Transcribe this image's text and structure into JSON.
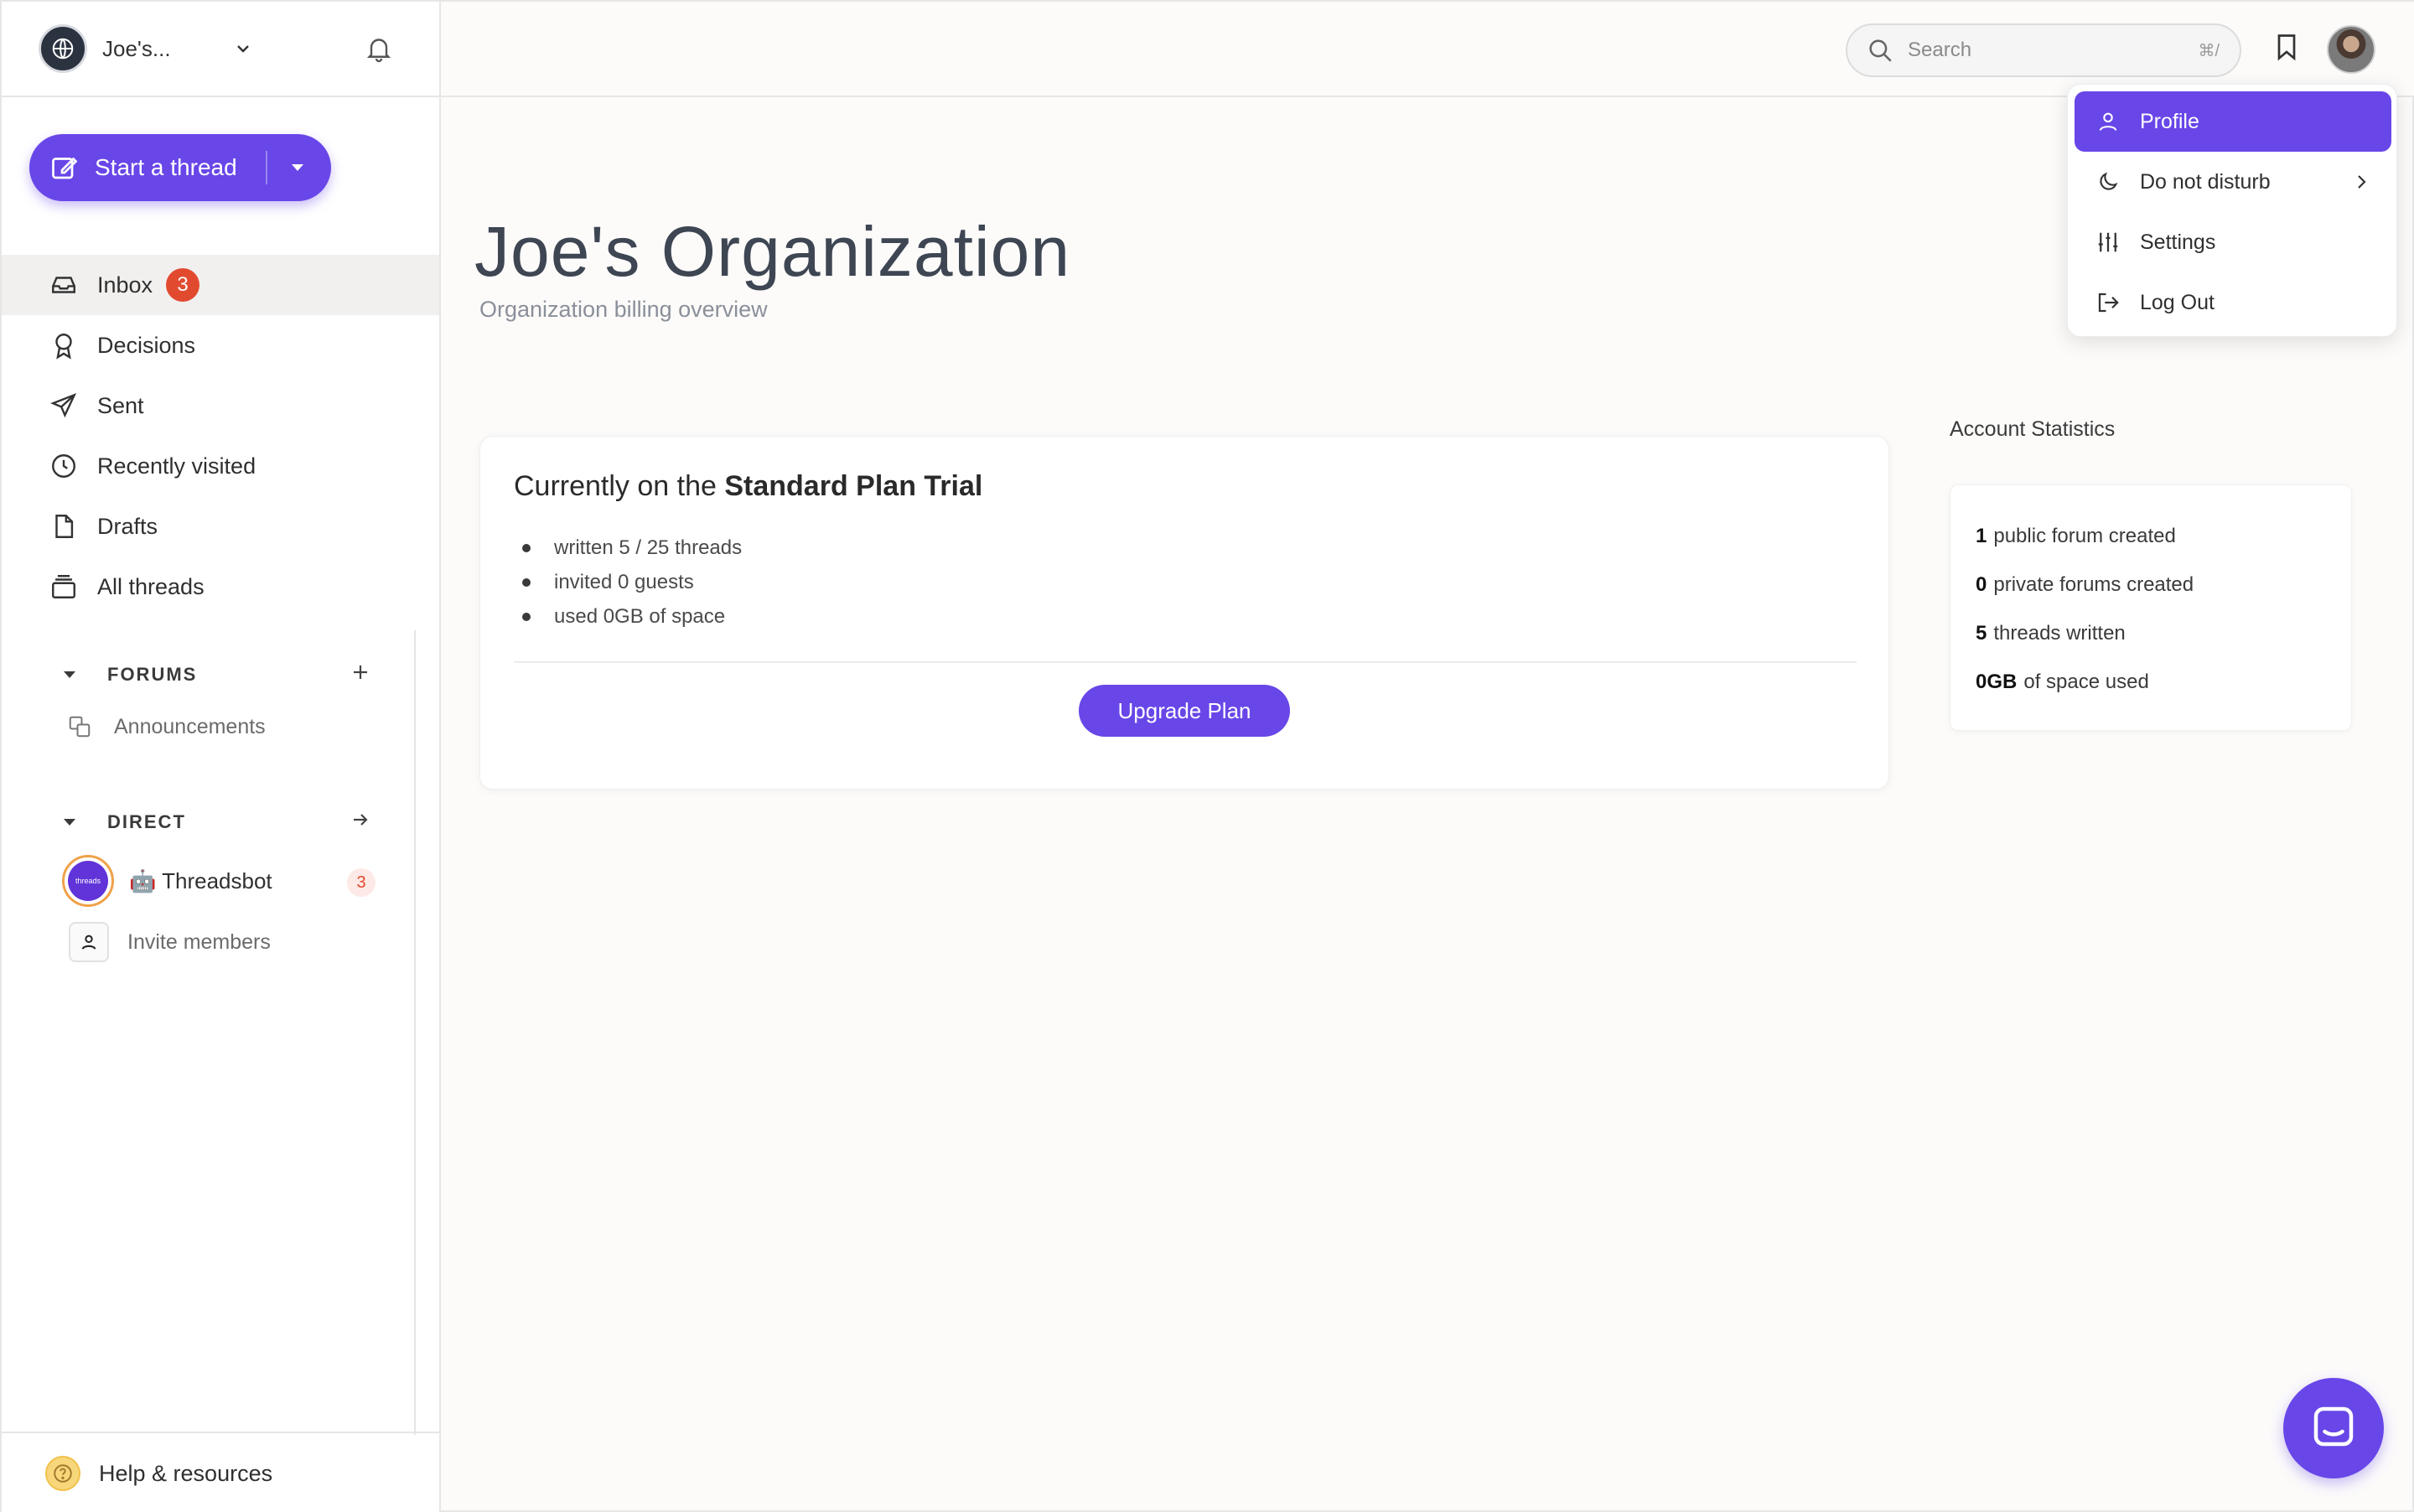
{
  "sidebar": {
    "org_name": "Joe's...",
    "start_thread_label": "Start a thread",
    "nav": [
      {
        "label": "Inbox",
        "badge": "3",
        "icon": "inbox-icon"
      },
      {
        "label": "Decisions",
        "icon": "award-icon"
      },
      {
        "label": "Sent",
        "icon": "send-icon"
      },
      {
        "label": "Recently visited",
        "icon": "clock-icon"
      },
      {
        "label": "Drafts",
        "icon": "file-icon"
      },
      {
        "label": "All threads",
        "icon": "stack-icon"
      }
    ],
    "forums_heading": "FORUMS",
    "forums": [
      {
        "label": "Announcements",
        "icon": "copy-icon"
      }
    ],
    "direct_heading": "DIRECT",
    "direct": [
      {
        "avatar_text": "threads",
        "label": "🤖 Threadsbot",
        "badge": "3"
      }
    ],
    "invite_label": "Invite members",
    "help_label": "Help & resources"
  },
  "topbar": {
    "search_placeholder": "Search",
    "search_shortcut": "⌘/"
  },
  "main": {
    "title": "Joe's Organization",
    "subtitle": "Organization billing overview",
    "plan": {
      "prefix": "Currently on the ",
      "name": "Standard Plan Trial",
      "items": [
        "written 5 / 25 threads",
        "invited 0 guests",
        "used 0GB of space"
      ],
      "upgrade_label": "Upgrade Plan"
    },
    "stats": {
      "heading": "Account Statistics",
      "items": [
        {
          "value": "1",
          "label": "public forum created"
        },
        {
          "value": "0",
          "label": "private forums created"
        },
        {
          "value": "5",
          "label": "threads written"
        },
        {
          "value": "0GB",
          "label": "of space used"
        }
      ]
    }
  },
  "user_menu": {
    "items": [
      {
        "label": "Profile",
        "icon": "user-icon",
        "active": true
      },
      {
        "label": "Do not disturb",
        "icon": "moon-icon",
        "submenu": true
      },
      {
        "label": "Settings",
        "icon": "sliders-icon"
      },
      {
        "label": "Log Out",
        "icon": "logout-icon"
      }
    ]
  },
  "colors": {
    "accent": "#6846e8",
    "badge_red": "#e24a30",
    "background": "#fcfbfa"
  }
}
